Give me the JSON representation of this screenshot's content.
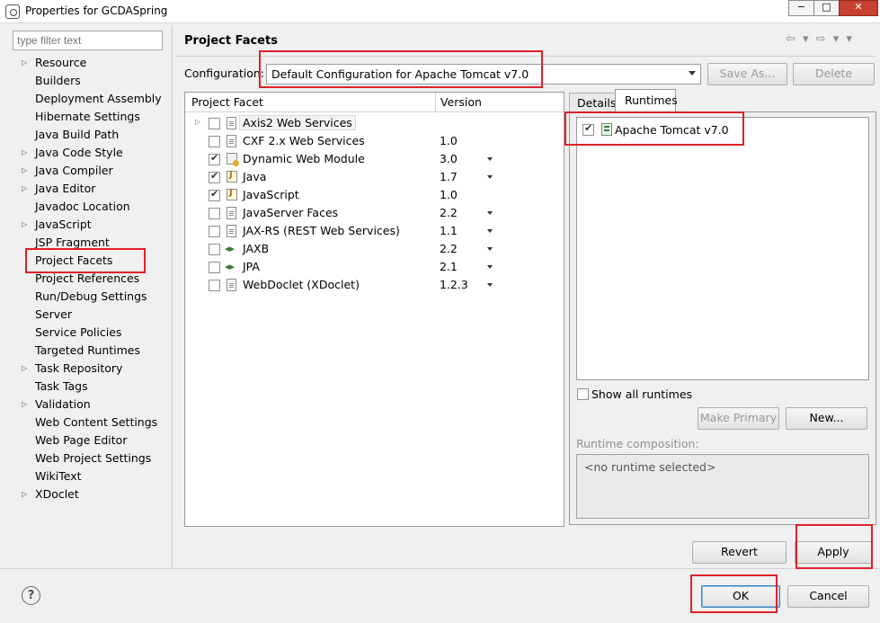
{
  "window": {
    "title": "Properties for GCDASpring",
    "controls": {
      "minimize": "−",
      "maximize": "□",
      "close": "✕"
    }
  },
  "sidebar": {
    "filter_placeholder": "type filter text",
    "items": [
      {
        "label": "Resource",
        "expandable": true
      },
      {
        "label": "Builders",
        "expandable": false
      },
      {
        "label": "Deployment Assembly",
        "expandable": false
      },
      {
        "label": "Hibernate Settings",
        "expandable": false
      },
      {
        "label": "Java Build Path",
        "expandable": false
      },
      {
        "label": "Java Code Style",
        "expandable": true
      },
      {
        "label": "Java Compiler",
        "expandable": true
      },
      {
        "label": "Java Editor",
        "expandable": true
      },
      {
        "label": "Javadoc Location",
        "expandable": false
      },
      {
        "label": "JavaScript",
        "expandable": true
      },
      {
        "label": "JSP Fragment",
        "expandable": false
      },
      {
        "label": "Project Facets",
        "expandable": false,
        "selected": true
      },
      {
        "label": "Project References",
        "expandable": false
      },
      {
        "label": "Run/Debug Settings",
        "expandable": false
      },
      {
        "label": "Server",
        "expandable": false
      },
      {
        "label": "Service Policies",
        "expandable": false
      },
      {
        "label": "Targeted Runtimes",
        "expandable": false
      },
      {
        "label": "Task Repository",
        "expandable": true
      },
      {
        "label": "Task Tags",
        "expandable": false
      },
      {
        "label": "Validation",
        "expandable": true
      },
      {
        "label": "Web Content Settings",
        "expandable": false
      },
      {
        "label": "Web Page Editor",
        "expandable": false
      },
      {
        "label": "Web Project Settings",
        "expandable": false
      },
      {
        "label": "WikiText",
        "expandable": false
      },
      {
        "label": "XDoclet",
        "expandable": true
      }
    ]
  },
  "header": {
    "title": "Project Facets",
    "nav": "⇦ ▾ ⇨ ▾ ▾"
  },
  "configuration": {
    "label": "Configuration:",
    "value": "Default Configuration for Apache Tomcat v7.0",
    "save_as": "Save As...",
    "delete": "Delete"
  },
  "facets": {
    "col_facet": "Project Facet",
    "col_version": "Version",
    "rows": [
      {
        "name": "Axis2 Web Services",
        "version": "",
        "checked": false,
        "expandable": true,
        "dropdown": false,
        "icon": "doc-icon"
      },
      {
        "name": "CXF 2.x Web Services",
        "version": "1.0",
        "checked": false,
        "expandable": false,
        "dropdown": false,
        "icon": "doc-icon"
      },
      {
        "name": "Dynamic Web Module",
        "version": "3.0",
        "checked": true,
        "expandable": false,
        "dropdown": true,
        "icon": "module-icon"
      },
      {
        "name": "Java",
        "version": "1.7",
        "checked": true,
        "expandable": false,
        "dropdown": true,
        "icon": "java-icon"
      },
      {
        "name": "JavaScript",
        "version": "1.0",
        "checked": true,
        "expandable": false,
        "dropdown": false,
        "icon": "java-icon"
      },
      {
        "name": "JavaServer Faces",
        "version": "2.2",
        "checked": false,
        "expandable": false,
        "dropdown": true,
        "icon": "doc-icon"
      },
      {
        "name": "JAX-RS (REST Web Services)",
        "version": "1.1",
        "checked": false,
        "expandable": false,
        "dropdown": true,
        "icon": "doc-icon"
      },
      {
        "name": "JAXB",
        "version": "2.2",
        "checked": false,
        "expandable": false,
        "dropdown": true,
        "icon": "arrows-icon"
      },
      {
        "name": "JPA",
        "version": "2.1",
        "checked": false,
        "expandable": false,
        "dropdown": true,
        "icon": "arrows-icon"
      },
      {
        "name": "WebDoclet (XDoclet)",
        "version": "1.2.3",
        "checked": false,
        "expandable": false,
        "dropdown": true,
        "icon": "doc-icon"
      }
    ]
  },
  "runtimes_panel": {
    "tab_details": "Details",
    "tab_runtimes": "Runtimes",
    "runtimes": [
      {
        "name": "Apache Tomcat v7.0",
        "checked": true
      }
    ],
    "show_all": "Show all runtimes",
    "make_primary": "Make Primary",
    "new": "New...",
    "composition_label": "Runtime composition:",
    "composition_value": "<no runtime selected>"
  },
  "footer": {
    "revert": "Revert",
    "apply": "Apply",
    "help": "?",
    "ok": "OK",
    "cancel": "Cancel"
  }
}
